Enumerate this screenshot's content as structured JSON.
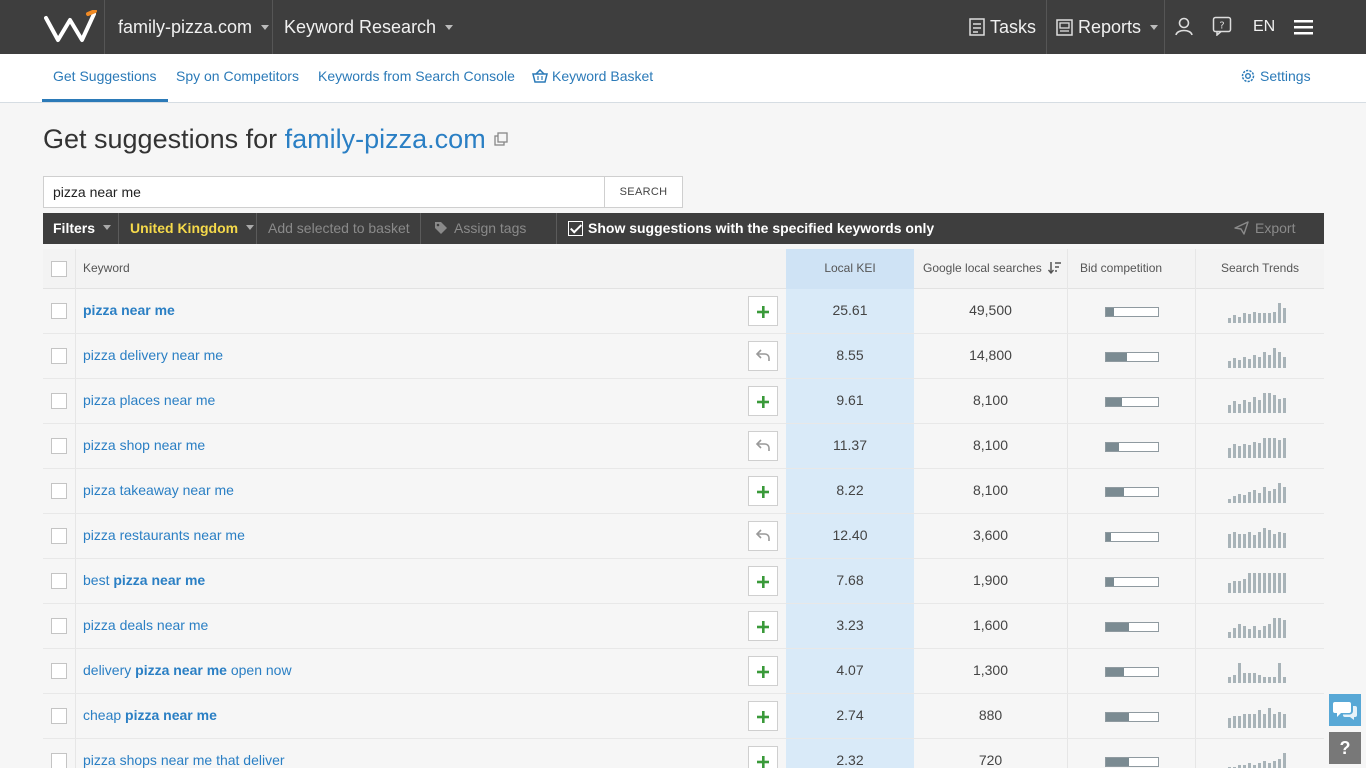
{
  "topbar": {
    "domain": "family-pizza.com",
    "module": "Keyword Research",
    "tasks": "Tasks",
    "reports": "Reports",
    "lang": "EN"
  },
  "nav": {
    "get_suggestions": "Get Suggestions",
    "spy_on_competitors": "Spy on Competitors",
    "keywords_from_search_console": "Keywords from Search Console",
    "keyword_basket": "Keyword Basket",
    "settings": "Settings"
  },
  "heading": {
    "prefix": "Get suggestions for",
    "domain": "family-pizza.com"
  },
  "search": {
    "value": "pizza near me",
    "button": "SEARCH"
  },
  "toolbar": {
    "filters": "Filters",
    "country": "United Kingdom",
    "add_to_basket": "Add selected to basket",
    "assign_tags": "Assign tags",
    "show_specified": "Show suggestions with the specified keywords only",
    "export": "Export"
  },
  "table": {
    "headers": {
      "keyword": "Keyword",
      "local_kei": "Local KEI",
      "google_local_searches": "Google local searches",
      "bid_competition": "Bid competition",
      "search_trends": "Search Trends"
    },
    "rows": [
      {
        "pre": "",
        "bold": "pizza near me",
        "post": "",
        "action": "add",
        "kei": "25.61",
        "searches": "49,500",
        "bid": 0.15,
        "trend": [
          4,
          6,
          5,
          8,
          7,
          9,
          8,
          8,
          8,
          9,
          16,
          12
        ]
      },
      {
        "pre": "pizza delivery near me",
        "bold": "",
        "post": "",
        "action": "undo",
        "kei": "8.55",
        "searches": "14,800",
        "bid": 0.4,
        "trend": [
          6,
          9,
          7,
          10,
          8,
          12,
          10,
          14,
          12,
          18,
          14,
          10
        ]
      },
      {
        "pre": "pizza places near me",
        "bold": "",
        "post": "",
        "action": "add",
        "kei": "9.61",
        "searches": "8,100",
        "bid": 0.3,
        "trend": [
          8,
          12,
          9,
          13,
          11,
          16,
          13,
          20,
          20,
          18,
          14,
          15
        ]
      },
      {
        "pre": "pizza shop near me",
        "bold": "",
        "post": "",
        "action": "undo",
        "kei": "11.37",
        "searches": "8,100",
        "bid": 0.25,
        "trend": [
          10,
          14,
          12,
          14,
          13,
          16,
          15,
          20,
          20,
          20,
          18,
          20
        ]
      },
      {
        "pre": "pizza takeaway near me",
        "bold": "",
        "post": "",
        "action": "add",
        "kei": "8.22",
        "searches": "8,100",
        "bid": 0.35,
        "trend": [
          4,
          6,
          8,
          7,
          10,
          12,
          9,
          14,
          11,
          13,
          18,
          14
        ]
      },
      {
        "pre": "pizza restaurants near me",
        "bold": "",
        "post": "",
        "action": "undo",
        "kei": "12.40",
        "searches": "3,600",
        "bid": 0.1,
        "trend": [
          14,
          16,
          14,
          14,
          16,
          13,
          16,
          20,
          18,
          14,
          16,
          15
        ]
      },
      {
        "pre": "best ",
        "bold": "pizza near me",
        "post": "",
        "action": "add",
        "kei": "7.68",
        "searches": "1,900",
        "bid": 0.15,
        "trend": [
          10,
          12,
          12,
          14,
          20,
          20,
          20,
          20,
          20,
          20,
          20,
          20
        ]
      },
      {
        "pre": "pizza deals near me",
        "bold": "",
        "post": "",
        "action": "add",
        "kei": "3.23",
        "searches": "1,600",
        "bid": 0.45,
        "trend": [
          6,
          10,
          14,
          12,
          9,
          12,
          8,
          12,
          14,
          20,
          20,
          18
        ]
      },
      {
        "pre": "delivery ",
        "bold": "pizza near me",
        "post": " open now",
        "action": "add",
        "kei": "4.07",
        "searches": "1,300",
        "bid": 0.35,
        "trend": [
          6,
          8,
          20,
          10,
          10,
          10,
          8,
          6,
          6,
          6,
          20,
          6
        ]
      },
      {
        "pre": "cheap ",
        "bold": "pizza near me",
        "post": "",
        "action": "add",
        "kei": "2.74",
        "searches": "880",
        "bid": 0.45,
        "trend": [
          10,
          12,
          12,
          14,
          14,
          14,
          18,
          14,
          20,
          14,
          16,
          14
        ]
      },
      {
        "pre": "pizza shops near me that deliver",
        "bold": "",
        "post": "",
        "action": "add",
        "kei": "2.32",
        "searches": "720",
        "bid": 0.45,
        "trend": [
          6,
          6,
          8,
          8,
          10,
          8,
          10,
          12,
          10,
          12,
          14,
          20
        ]
      }
    ]
  }
}
